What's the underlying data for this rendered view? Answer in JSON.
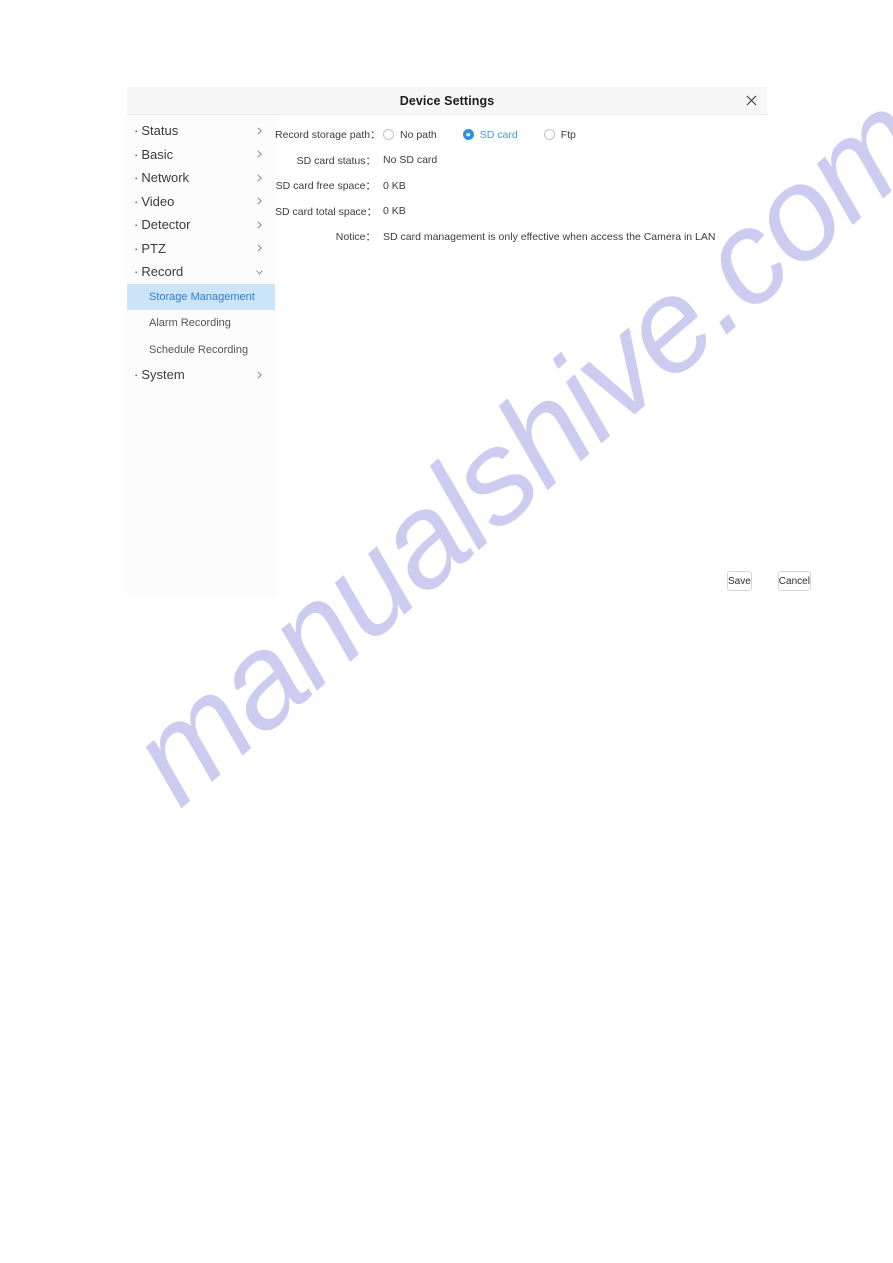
{
  "dialog": {
    "title": "Device Settings",
    "close_icon": "close-icon"
  },
  "sidebar": {
    "items": [
      {
        "label": "Status",
        "bullet": "·",
        "chevron": "chevron-right-icon"
      },
      {
        "label": "Basic",
        "bullet": "·",
        "chevron": "chevron-right-icon"
      },
      {
        "label": "Network",
        "bullet": "·",
        "chevron": "chevron-right-icon"
      },
      {
        "label": "Video",
        "bullet": "·",
        "chevron": "chevron-right-icon"
      },
      {
        "label": "Detector",
        "bullet": "·",
        "chevron": "chevron-right-icon"
      },
      {
        "label": "PTZ",
        "bullet": "·",
        "chevron": "chevron-right-icon"
      },
      {
        "label": "Record",
        "bullet": "·",
        "chevron": "chevron-down-icon"
      },
      {
        "label": "System",
        "bullet": "·",
        "chevron": "chevron-right-icon"
      }
    ],
    "sub_items": [
      {
        "label": "Storage Management",
        "active": true
      },
      {
        "label": "Alarm Recording",
        "active": false
      },
      {
        "label": "Schedule Recording",
        "active": false
      }
    ],
    "active_color": "#2f7fd0",
    "active_bg": "#cce4f7"
  },
  "form": {
    "storage_path": {
      "label": "Record storage path：",
      "options": [
        {
          "label": "No path",
          "checked": false
        },
        {
          "label": "SD card",
          "checked": true
        },
        {
          "label": "Ftp",
          "checked": false
        }
      ]
    },
    "rows": [
      {
        "label": "SD card status：",
        "value": "No SD card"
      },
      {
        "label": "SD card free space：",
        "value": "0 KB"
      },
      {
        "label": "SD card total space：",
        "value": "0 KB"
      }
    ],
    "notice": {
      "label": "Notice：",
      "value": "SD card management is only effective when access the Camera in LAN"
    }
  },
  "footer": {
    "save_label": "Save",
    "cancel_label": "Cancel"
  },
  "watermark": {
    "text": "manualshive.com",
    "color": "#ccccf0"
  }
}
